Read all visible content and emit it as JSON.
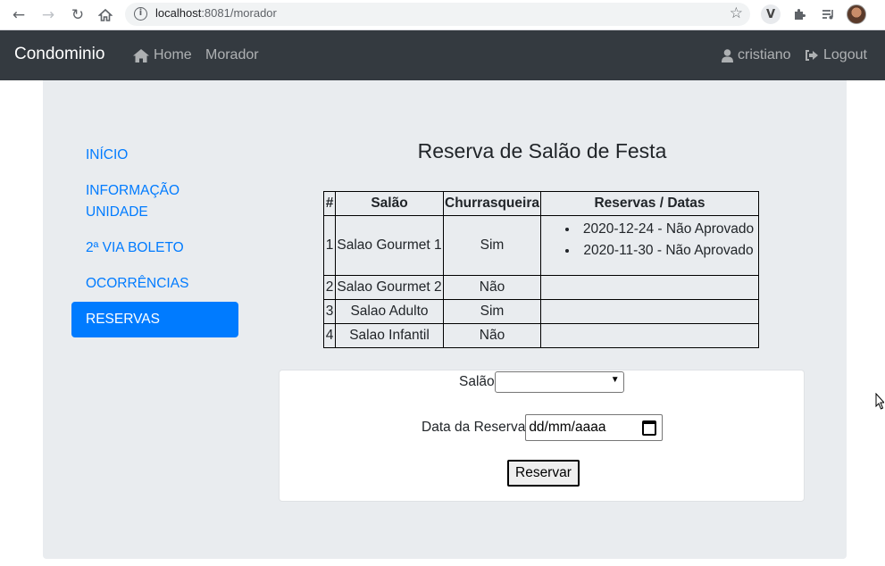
{
  "browser": {
    "url_host": "localhost",
    "url_rest": ":8081/morador"
  },
  "navbar": {
    "brand": "Condominio",
    "links": [
      "Home",
      "Morador"
    ],
    "user": "cristiano",
    "logout": "Logout"
  },
  "sidebar": {
    "items": [
      {
        "label": "INÍCIO"
      },
      {
        "label": "INFORMAÇÃO UNIDADE"
      },
      {
        "label": "2ª VIA BOLETO"
      },
      {
        "label": "OCORRÊNCIAS"
      },
      {
        "label": "RESERVAS"
      }
    ]
  },
  "main": {
    "title": "Reserva de Salão de Festa",
    "table": {
      "headers": [
        "#",
        "Salão",
        "Churrasqueira",
        "Reservas / Datas"
      ],
      "rows": [
        {
          "num": "1",
          "salao": "Salao Gourmet 1",
          "churrasqueira": "Sim",
          "reservas": [
            "2020-12-24 - Não Aprovado",
            "2020-11-30 - Não Aprovado"
          ]
        },
        {
          "num": "2",
          "salao": "Salao Gourmet 2",
          "churrasqueira": "Não",
          "reservas": []
        },
        {
          "num": "3",
          "salao": "Salao Adulto",
          "churrasqueira": "Sim",
          "reservas": []
        },
        {
          "num": "4",
          "salao": "Salao Infantil",
          "churrasqueira": "Não",
          "reservas": []
        }
      ]
    },
    "form": {
      "salao_label": "Salão",
      "salao_value": "",
      "data_label": "Data da Reserva",
      "data_placeholder": "dd/mm/aaaa",
      "submit_label": "Reservar"
    }
  },
  "colors": {
    "navbar_bg": "#343a40",
    "panel_bg": "#e9ecef",
    "accent": "#007bff"
  }
}
